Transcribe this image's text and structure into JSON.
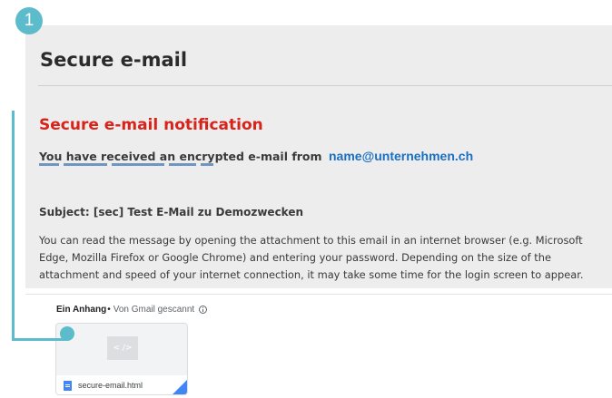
{
  "step": {
    "number": "1"
  },
  "email": {
    "title": "Secure e-mail",
    "notification_heading": "Secure e-mail notification",
    "received_text": "You have received an encrypted e-mail from",
    "sender_address": "name@unternehmen.ch",
    "subject": "Subject: [sec] Test E-Mail zu Demozwecken",
    "body_lines": [
      "You can read the message by opening the attachment to this email in an internet browser (e.g. Microsoft",
      "Edge, Mozilla Firefox or Google Chrome) and entering your password. Depending on the size of the",
      "attachment and speed of your internet connection, it may take some time for the login screen to appear."
    ]
  },
  "attachments": {
    "count_label": "Ein Anhang",
    "separator": "•",
    "scan_label": "Von Gmail gescannt",
    "preview_glyph": "< />",
    "file_name": "secure-email.html"
  },
  "colors": {
    "accent_teal": "#5cbccb",
    "heading_red": "#d8231a",
    "link_blue": "#1a6fc2",
    "panel_gray": "#ededed",
    "file_blue": "#4285f4"
  },
  "icons": {
    "info": "info-circle-icon",
    "file": "document-file-icon",
    "code": "code-icon"
  }
}
